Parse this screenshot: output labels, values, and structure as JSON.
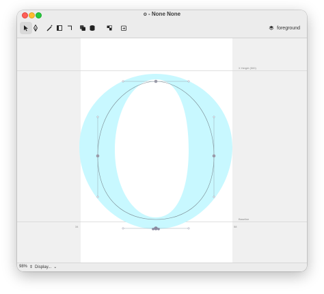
{
  "window": {
    "title": "o - None None"
  },
  "toolbar": {
    "tools": [
      {
        "name": "pointer-tool",
        "icon": "arrow-cursor-icon",
        "active": true
      },
      {
        "name": "pen-tool",
        "icon": "pen-nib-icon",
        "active": false
      },
      {
        "name": "knife-tool",
        "icon": "knife-icon",
        "active": false
      },
      {
        "name": "corner-tool",
        "icon": "corner-icon",
        "active": false
      },
      {
        "name": "hook-tool",
        "icon": "hook-icon",
        "active": false
      },
      {
        "name": "layers-tool",
        "icon": "overlap-icon",
        "active": false
      },
      {
        "name": "stack-tool",
        "icon": "database-icon",
        "active": false
      },
      {
        "name": "arrange-tool",
        "icon": "arrange-icon",
        "active": false
      },
      {
        "name": "export-tool",
        "icon": "export-icon",
        "active": false
      }
    ],
    "layer": {
      "label": "foreground",
      "icon": "layers-icon"
    }
  },
  "canvas": {
    "glyph_char": "O",
    "fill_color": "#c8f8ff",
    "guides": {
      "x_height_label": "X Height (500)",
      "baseline_label": "Baseline",
      "left_sidebearing": "34",
      "right_sidebearing": "58"
    }
  },
  "status": {
    "zoom": "98%",
    "display_mode": "Display..."
  }
}
